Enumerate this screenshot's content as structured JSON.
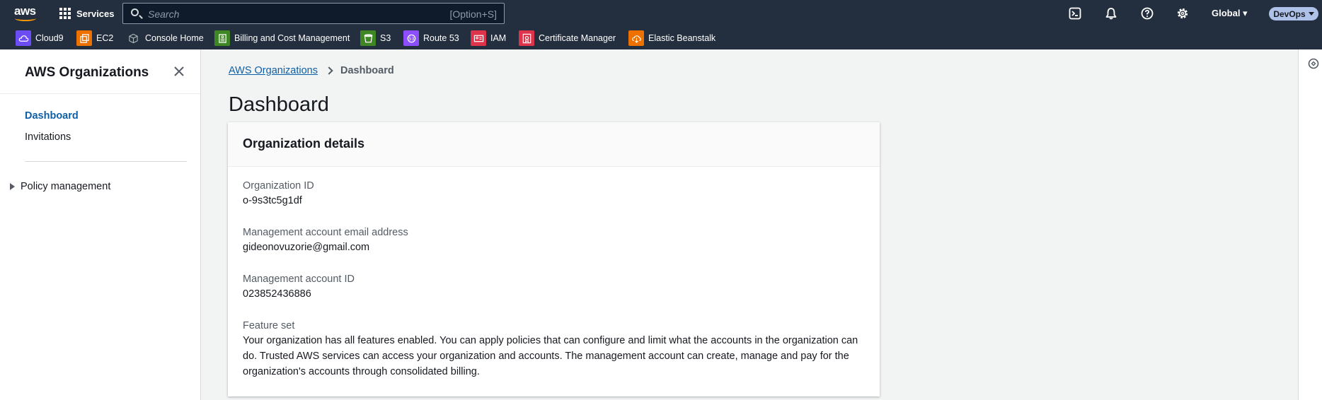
{
  "topnav": {
    "services_label": "Services",
    "search_placeholder": "Search",
    "search_shortcut": "[Option+S]",
    "region_label": "Global ▾",
    "account_label": "DevOps"
  },
  "favorites": [
    {
      "label": "Cloud9",
      "color": "#6b4cf5",
      "icon": "cloud9-icon"
    },
    {
      "label": "EC2",
      "color": "#ed7100",
      "icon": "ec2-icon"
    },
    {
      "label": "Console Home",
      "color": "#232f3e",
      "icon": "console-home-icon"
    },
    {
      "label": "Billing and Cost Management",
      "color": "#3f8624",
      "icon": "billing-icon"
    },
    {
      "label": "S3",
      "color": "#3f8624",
      "icon": "s3-icon"
    },
    {
      "label": "Route 53",
      "color": "#8c4fff",
      "icon": "route53-icon"
    },
    {
      "label": "IAM",
      "color": "#dd344c",
      "icon": "iam-icon"
    },
    {
      "label": "Certificate Manager",
      "color": "#dd344c",
      "icon": "certificate-manager-icon"
    },
    {
      "label": "Elastic Beanstalk",
      "color": "#ed7100",
      "icon": "elastic-beanstalk-icon"
    }
  ],
  "sidebar": {
    "title": "AWS Organizations",
    "items": [
      {
        "label": "Dashboard",
        "active": true
      },
      {
        "label": "Invitations",
        "active": false
      }
    ],
    "section": "Policy management"
  },
  "breadcrumb": {
    "root": "AWS Organizations",
    "current": "Dashboard"
  },
  "page": {
    "title": "Dashboard"
  },
  "card": {
    "title": "Organization details",
    "fields": [
      {
        "label": "Organization ID",
        "value": "o-9s3tc5g1df"
      },
      {
        "label": "Management account email address",
        "value": "gideonovuzorie@gmail.com"
      },
      {
        "label": "Management account ID",
        "value": "023852436886"
      },
      {
        "label": "Feature set",
        "value": "Your organization has all features enabled. You can apply policies that can configure and limit what the accounts in the organization can do. Trusted AWS services can access your organization and accounts. The management account can create, manage and pay for the organization's accounts through consolidated billing."
      }
    ]
  },
  "colors": {
    "nav_bg": "#232f3e",
    "link": "#0f5fa8",
    "accent_orange": "#ff9900"
  }
}
